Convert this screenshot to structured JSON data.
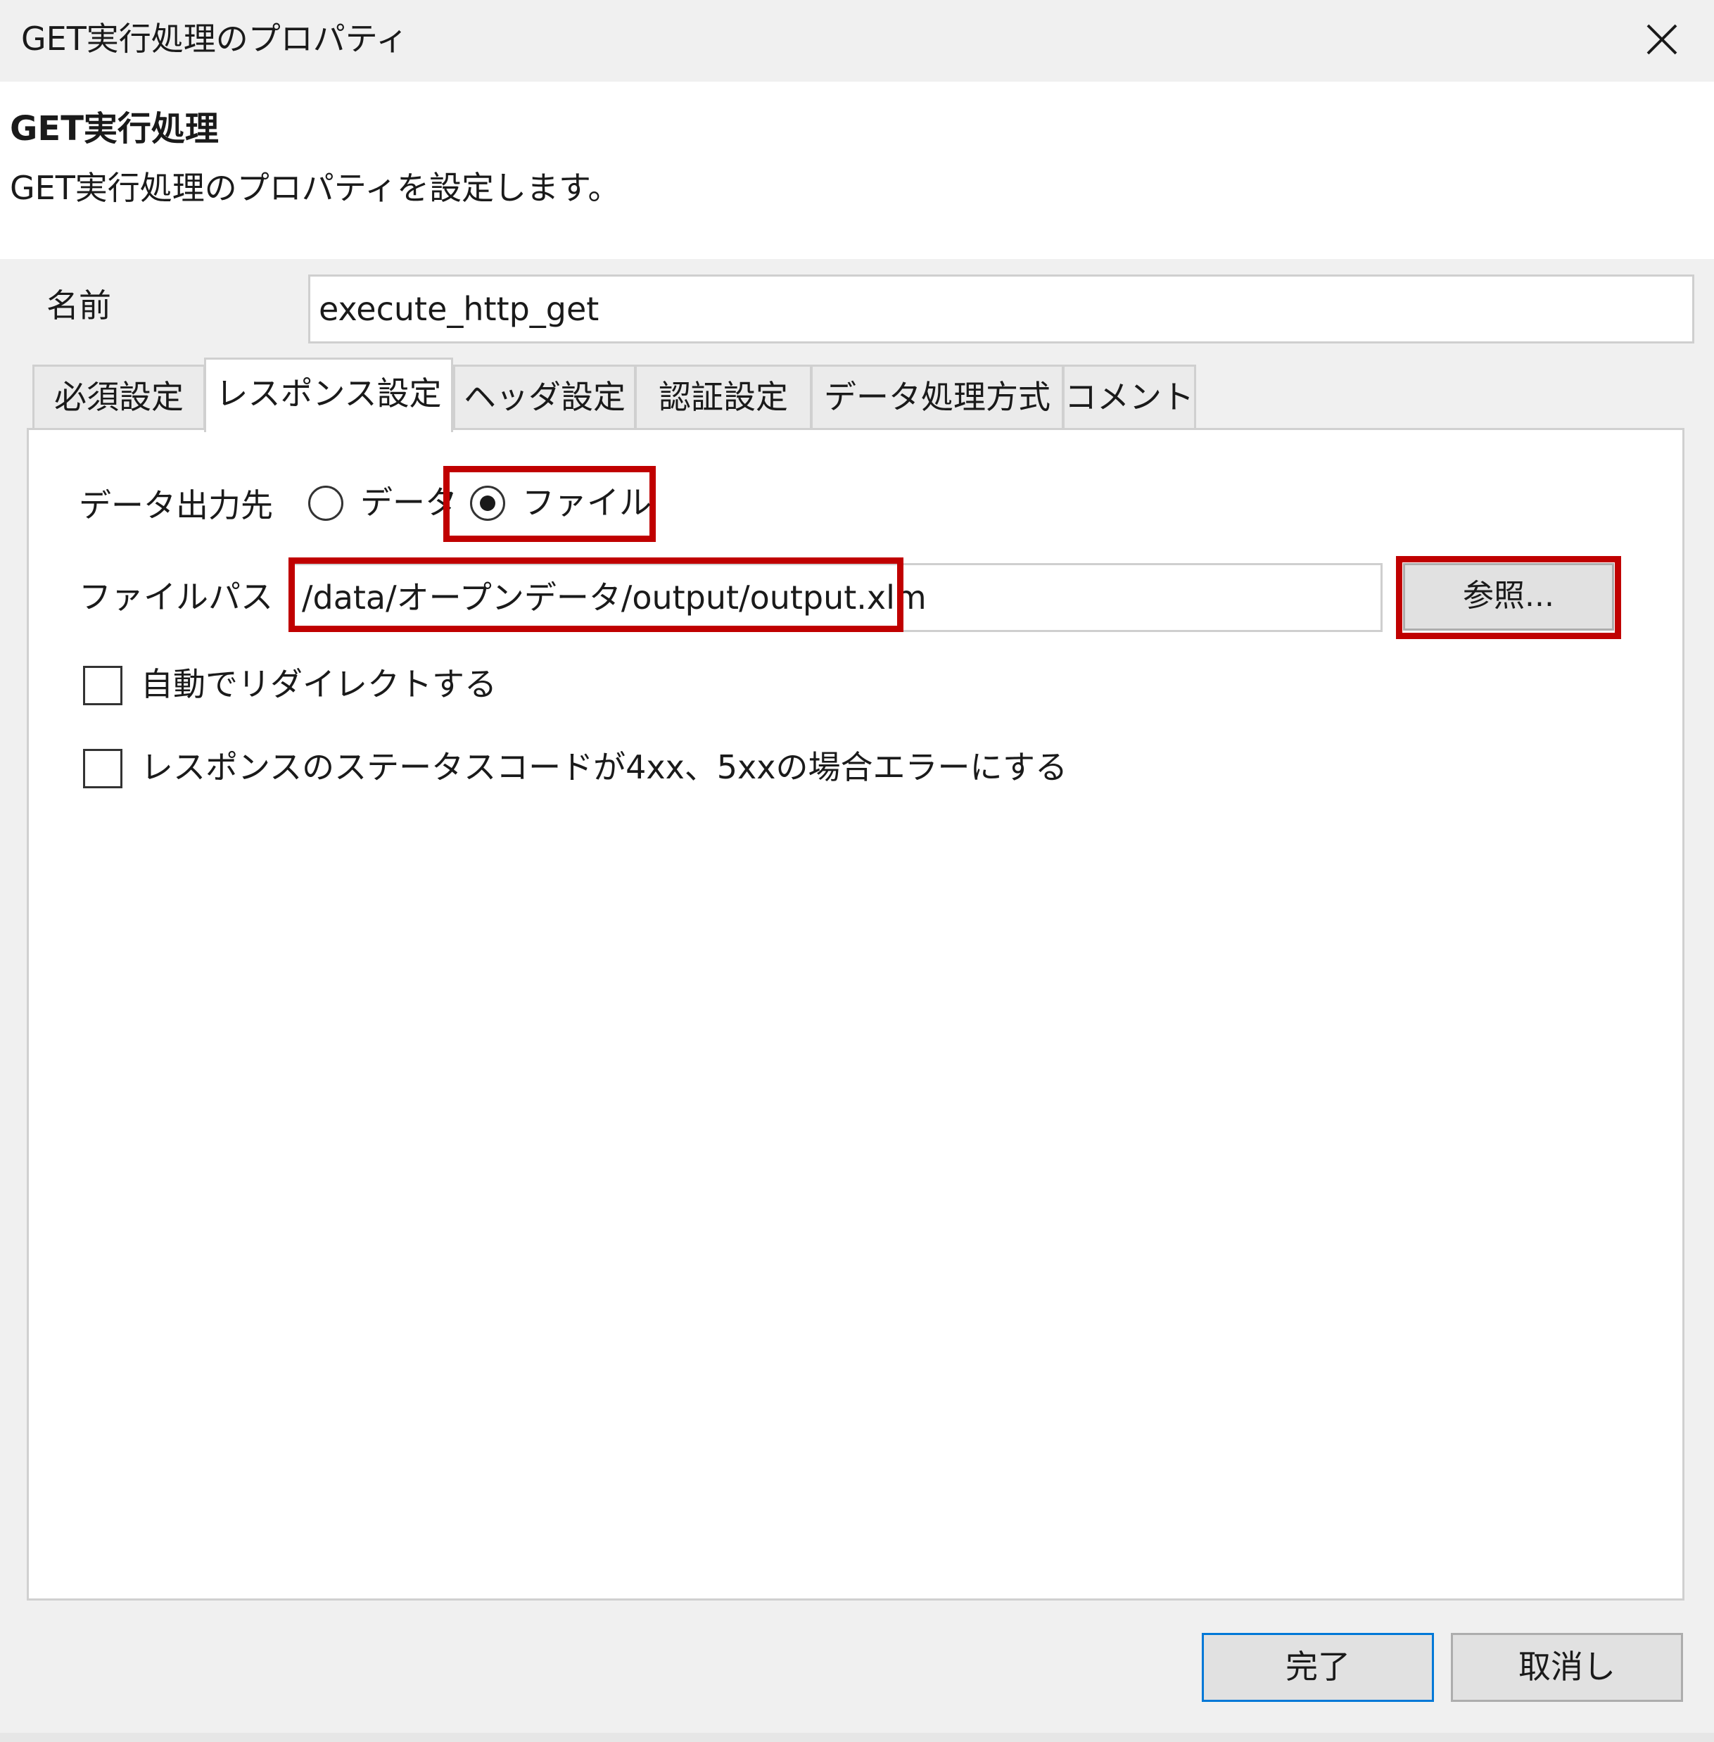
{
  "window": {
    "title": "GET実行処理のプロパティ",
    "close_icon": "close-icon"
  },
  "header": {
    "heading": "GET実行処理",
    "description": "GET実行処理のプロパティを設定します。"
  },
  "name_field": {
    "label": "名前",
    "value": "execute_http_get"
  },
  "tabs": [
    {
      "label": "必須設定",
      "active": false
    },
    {
      "label": "レスポンス設定",
      "active": true
    },
    {
      "label": "ヘッダ設定",
      "active": false
    },
    {
      "label": "認証設定",
      "active": false
    },
    {
      "label": "データ処理方式",
      "active": false
    },
    {
      "label": "コメント",
      "active": false
    }
  ],
  "response": {
    "output_label": "データ出力先",
    "option_data": "データ",
    "option_file": "ファイル",
    "selected": "ファイル",
    "file_path_label": "ファイルパス",
    "file_path_value": "/data/オープンデータ/output/output.xlm",
    "browse_label": "参照...",
    "redirect_label": "自動でリダイレクトする",
    "redirect_checked": false,
    "error_label": "レスポンスのステータスコードが4xx、5xxの場合エラーにする",
    "error_checked": false
  },
  "footer": {
    "finish_label": "完了",
    "cancel_label": "取消し"
  },
  "colors": {
    "highlight": "#c00000",
    "default_button_border": "#0078d7"
  }
}
